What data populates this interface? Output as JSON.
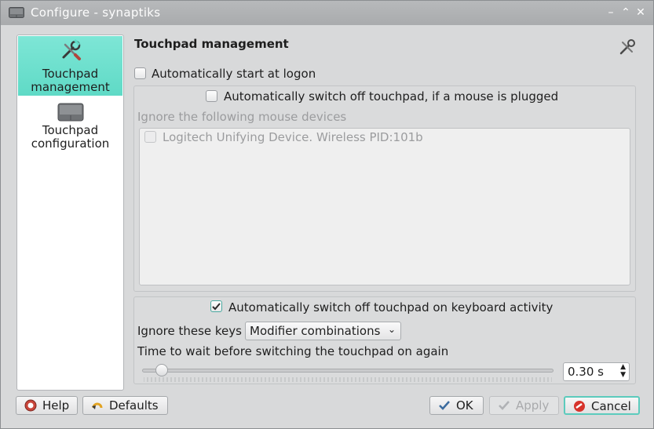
{
  "window": {
    "title": "Configure  -  synaptiks"
  },
  "sidebar": {
    "items": [
      {
        "label_line1": "Touchpad",
        "label_line2": "management",
        "icon": "wrench-screwdriver-icon",
        "active": true
      },
      {
        "label_line1": "Touchpad",
        "label_line2": "configuration",
        "icon": "touchpad-icon",
        "active": false
      }
    ]
  },
  "page": {
    "title": "Touchpad management",
    "auto_start": {
      "label": "Automatically start at logon",
      "checked": false
    },
    "mouse_switch": {
      "label": "Automatically switch off touchpad, if a mouse is plugged",
      "checked": false
    },
    "ignore_mouse_label": "Ignore the following mouse devices",
    "devices": [
      {
        "label": "Logitech Unifying Device. Wireless PID:101b",
        "checked": false
      }
    ],
    "keyboard_switch": {
      "label": "Automatically switch off touchpad on keyboard activity",
      "checked": true
    },
    "ignore_keys_label": "Ignore these keys",
    "ignore_keys_value": "Modifier combinations",
    "wait_label": "Time to wait before switching the touchpad on again",
    "wait_value": "0.30 s",
    "wait_slider_fraction": 0.03
  },
  "buttons": {
    "help": "Help",
    "defaults": "Defaults",
    "ok": "OK",
    "apply": "Apply",
    "cancel": "Cancel"
  },
  "colors": {
    "accent": "#5fdac6",
    "checked": "#4aa9a0"
  }
}
